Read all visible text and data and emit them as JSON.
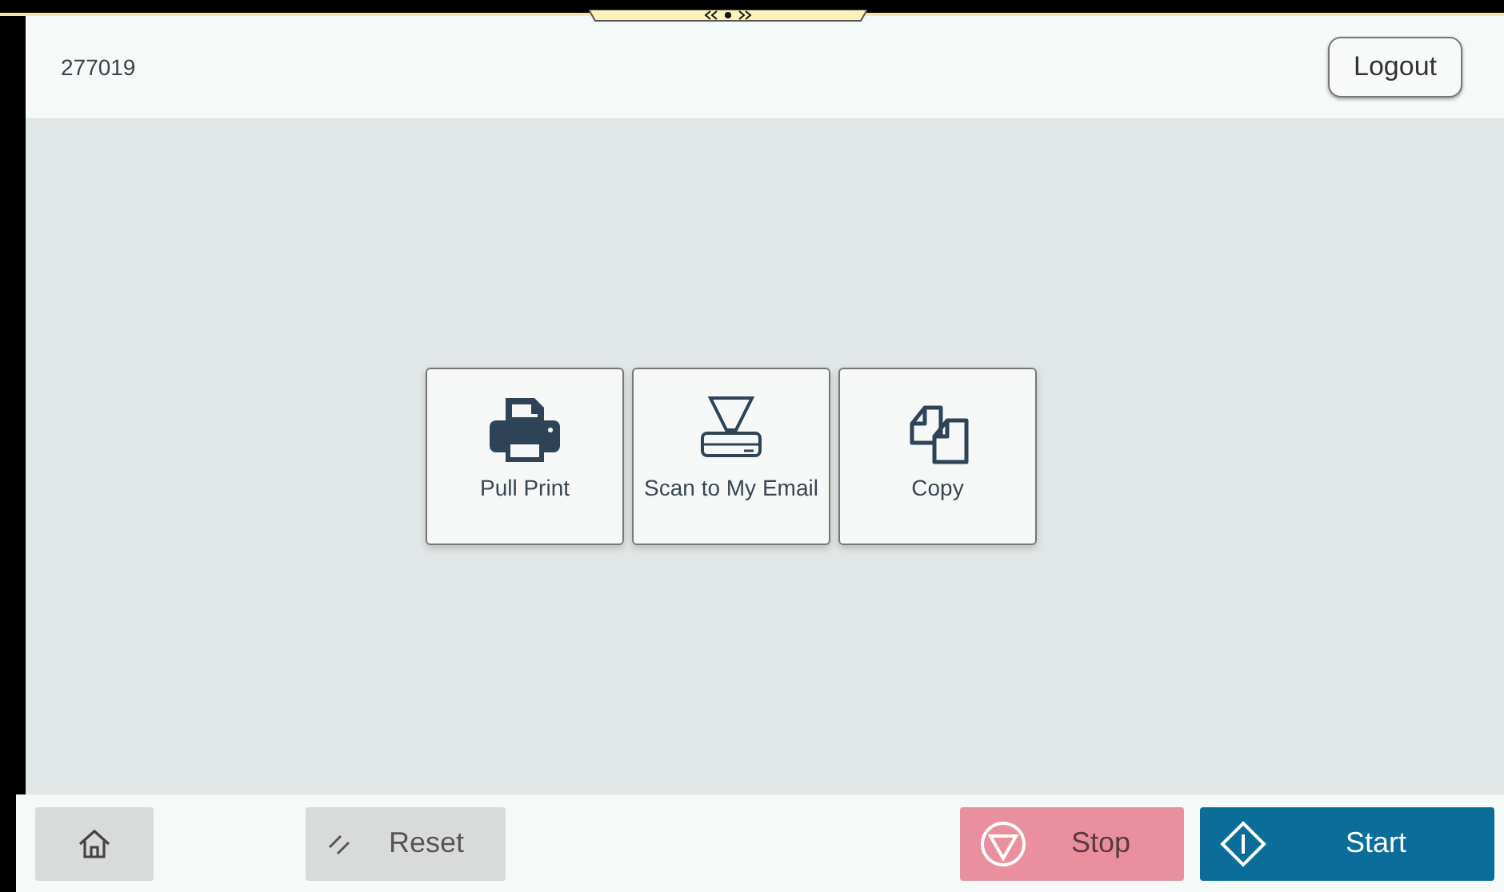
{
  "header": {
    "user_id": "277019",
    "logout": "Logout"
  },
  "apps": [
    {
      "kind": "print",
      "label": "Pull Print"
    },
    {
      "kind": "scan",
      "label": "Scan to My Email"
    },
    {
      "kind": "copy",
      "label": "Copy"
    }
  ],
  "footer": {
    "reset": "Reset",
    "stop": "Stop",
    "start": "Start"
  }
}
